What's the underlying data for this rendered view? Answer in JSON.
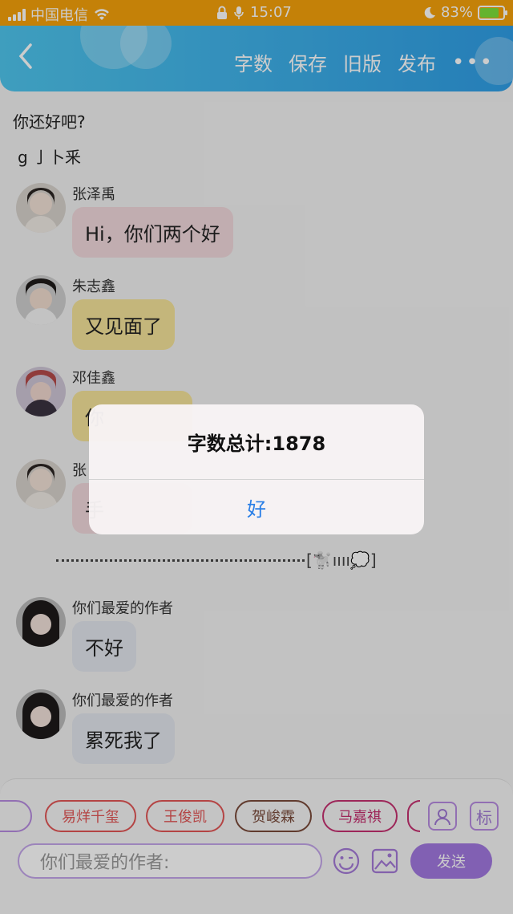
{
  "status_bar": {
    "carrier": "中国电信",
    "time": "15:07",
    "battery": "83%",
    "battery_level": 0.83
  },
  "nav": {
    "actions": [
      "字数",
      "保存",
      "旧版",
      "发布"
    ],
    "more": "•••"
  },
  "chat": {
    "lines": [
      "你还好吧?",
      "g 亅卜釆"
    ],
    "messages": [
      {
        "sender": "张泽禹",
        "text": "Hi，你们两个好",
        "bubble_color": "#f2d9dd"
      },
      {
        "sender": "朱志鑫",
        "text": "又见面了",
        "bubble_color": "#f5e49a"
      },
      {
        "sender": "邓佳鑫",
        "text": "你",
        "bubble_color": "#f5e49a"
      },
      {
        "sender": "张",
        "text": "手",
        "bubble_color": "#f2d9dd"
      },
      {
        "sender": "你们最爱的作者",
        "text": "不好",
        "bubble_color": "#e3e7ee"
      },
      {
        "sender": "你们最爱的作者",
        "text": "累死我了",
        "bubble_color": "#e3e7ee"
      }
    ],
    "divider_tail": "[🐩ıııı💭]"
  },
  "bottom": {
    "chips": [
      {
        "label": "易烊千玺",
        "color": "#e25555"
      },
      {
        "label": "王俊凯",
        "color": "#e25555"
      },
      {
        "label": "贺峻霖",
        "color": "#7a4a3a"
      },
      {
        "label": "马嘉祺",
        "color": "#c53070"
      }
    ],
    "side_button_label": "标",
    "input_placeholder": "你们最爱的作者:",
    "send_label": "发送"
  },
  "dialog": {
    "title": "字数总计:1878",
    "ok_label": "好"
  }
}
